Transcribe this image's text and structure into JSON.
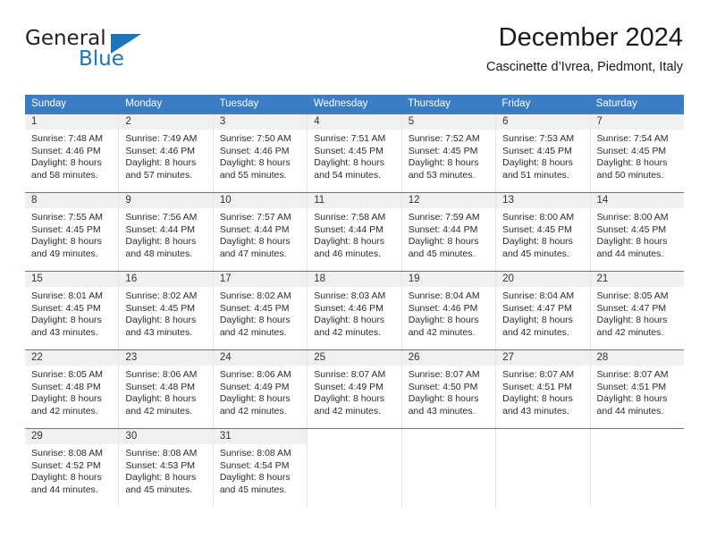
{
  "brand": {
    "name_top": "General",
    "name_bottom": "Blue",
    "color_top": "#231f20",
    "color_bottom": "#1b75bb",
    "triangle_icon": "triangle-icon"
  },
  "header": {
    "title": "December 2024",
    "subtitle": "Cascinette d’Ivrea, Piedmont, Italy"
  },
  "theme": {
    "header_blue": "#3b7dc4",
    "daynum_band": "#f0f0f0",
    "grid_line": "#e6e6e6",
    "row_top_border": "#4a7fbd"
  },
  "weekdays": [
    "Sunday",
    "Monday",
    "Tuesday",
    "Wednesday",
    "Thursday",
    "Friday",
    "Saturday"
  ],
  "weeks": [
    [
      {
        "day": "1",
        "sunrise": "Sunrise: 7:48 AM",
        "sunset": "Sunset: 4:46 PM",
        "daylight1": "Daylight: 8 hours",
        "daylight2": "and 58 minutes."
      },
      {
        "day": "2",
        "sunrise": "Sunrise: 7:49 AM",
        "sunset": "Sunset: 4:46 PM",
        "daylight1": "Daylight: 8 hours",
        "daylight2": "and 57 minutes."
      },
      {
        "day": "3",
        "sunrise": "Sunrise: 7:50 AM",
        "sunset": "Sunset: 4:46 PM",
        "daylight1": "Daylight: 8 hours",
        "daylight2": "and 55 minutes."
      },
      {
        "day": "4",
        "sunrise": "Sunrise: 7:51 AM",
        "sunset": "Sunset: 4:45 PM",
        "daylight1": "Daylight: 8 hours",
        "daylight2": "and 54 minutes."
      },
      {
        "day": "5",
        "sunrise": "Sunrise: 7:52 AM",
        "sunset": "Sunset: 4:45 PM",
        "daylight1": "Daylight: 8 hours",
        "daylight2": "and 53 minutes."
      },
      {
        "day": "6",
        "sunrise": "Sunrise: 7:53 AM",
        "sunset": "Sunset: 4:45 PM",
        "daylight1": "Daylight: 8 hours",
        "daylight2": "and 51 minutes."
      },
      {
        "day": "7",
        "sunrise": "Sunrise: 7:54 AM",
        "sunset": "Sunset: 4:45 PM",
        "daylight1": "Daylight: 8 hours",
        "daylight2": "and 50 minutes."
      }
    ],
    [
      {
        "day": "8",
        "sunrise": "Sunrise: 7:55 AM",
        "sunset": "Sunset: 4:45 PM",
        "daylight1": "Daylight: 8 hours",
        "daylight2": "and 49 minutes."
      },
      {
        "day": "9",
        "sunrise": "Sunrise: 7:56 AM",
        "sunset": "Sunset: 4:44 PM",
        "daylight1": "Daylight: 8 hours",
        "daylight2": "and 48 minutes."
      },
      {
        "day": "10",
        "sunrise": "Sunrise: 7:57 AM",
        "sunset": "Sunset: 4:44 PM",
        "daylight1": "Daylight: 8 hours",
        "daylight2": "and 47 minutes."
      },
      {
        "day": "11",
        "sunrise": "Sunrise: 7:58 AM",
        "sunset": "Sunset: 4:44 PM",
        "daylight1": "Daylight: 8 hours",
        "daylight2": "and 46 minutes."
      },
      {
        "day": "12",
        "sunrise": "Sunrise: 7:59 AM",
        "sunset": "Sunset: 4:44 PM",
        "daylight1": "Daylight: 8 hours",
        "daylight2": "and 45 minutes."
      },
      {
        "day": "13",
        "sunrise": "Sunrise: 8:00 AM",
        "sunset": "Sunset: 4:45 PM",
        "daylight1": "Daylight: 8 hours",
        "daylight2": "and 45 minutes."
      },
      {
        "day": "14",
        "sunrise": "Sunrise: 8:00 AM",
        "sunset": "Sunset: 4:45 PM",
        "daylight1": "Daylight: 8 hours",
        "daylight2": "and 44 minutes."
      }
    ],
    [
      {
        "day": "15",
        "sunrise": "Sunrise: 8:01 AM",
        "sunset": "Sunset: 4:45 PM",
        "daylight1": "Daylight: 8 hours",
        "daylight2": "and 43 minutes."
      },
      {
        "day": "16",
        "sunrise": "Sunrise: 8:02 AM",
        "sunset": "Sunset: 4:45 PM",
        "daylight1": "Daylight: 8 hours",
        "daylight2": "and 43 minutes."
      },
      {
        "day": "17",
        "sunrise": "Sunrise: 8:02 AM",
        "sunset": "Sunset: 4:45 PM",
        "daylight1": "Daylight: 8 hours",
        "daylight2": "and 42 minutes."
      },
      {
        "day": "18",
        "sunrise": "Sunrise: 8:03 AM",
        "sunset": "Sunset: 4:46 PM",
        "daylight1": "Daylight: 8 hours",
        "daylight2": "and 42 minutes."
      },
      {
        "day": "19",
        "sunrise": "Sunrise: 8:04 AM",
        "sunset": "Sunset: 4:46 PM",
        "daylight1": "Daylight: 8 hours",
        "daylight2": "and 42 minutes."
      },
      {
        "day": "20",
        "sunrise": "Sunrise: 8:04 AM",
        "sunset": "Sunset: 4:47 PM",
        "daylight1": "Daylight: 8 hours",
        "daylight2": "and 42 minutes."
      },
      {
        "day": "21",
        "sunrise": "Sunrise: 8:05 AM",
        "sunset": "Sunset: 4:47 PM",
        "daylight1": "Daylight: 8 hours",
        "daylight2": "and 42 minutes."
      }
    ],
    [
      {
        "day": "22",
        "sunrise": "Sunrise: 8:05 AM",
        "sunset": "Sunset: 4:48 PM",
        "daylight1": "Daylight: 8 hours",
        "daylight2": "and 42 minutes."
      },
      {
        "day": "23",
        "sunrise": "Sunrise: 8:06 AM",
        "sunset": "Sunset: 4:48 PM",
        "daylight1": "Daylight: 8 hours",
        "daylight2": "and 42 minutes."
      },
      {
        "day": "24",
        "sunrise": "Sunrise: 8:06 AM",
        "sunset": "Sunset: 4:49 PM",
        "daylight1": "Daylight: 8 hours",
        "daylight2": "and 42 minutes."
      },
      {
        "day": "25",
        "sunrise": "Sunrise: 8:07 AM",
        "sunset": "Sunset: 4:49 PM",
        "daylight1": "Daylight: 8 hours",
        "daylight2": "and 42 minutes."
      },
      {
        "day": "26",
        "sunrise": "Sunrise: 8:07 AM",
        "sunset": "Sunset: 4:50 PM",
        "daylight1": "Daylight: 8 hours",
        "daylight2": "and 43 minutes."
      },
      {
        "day": "27",
        "sunrise": "Sunrise: 8:07 AM",
        "sunset": "Sunset: 4:51 PM",
        "daylight1": "Daylight: 8 hours",
        "daylight2": "and 43 minutes."
      },
      {
        "day": "28",
        "sunrise": "Sunrise: 8:07 AM",
        "sunset": "Sunset: 4:51 PM",
        "daylight1": "Daylight: 8 hours",
        "daylight2": "and 44 minutes."
      }
    ],
    [
      {
        "day": "29",
        "sunrise": "Sunrise: 8:08 AM",
        "sunset": "Sunset: 4:52 PM",
        "daylight1": "Daylight: 8 hours",
        "daylight2": "and 44 minutes."
      },
      {
        "day": "30",
        "sunrise": "Sunrise: 8:08 AM",
        "sunset": "Sunset: 4:53 PM",
        "daylight1": "Daylight: 8 hours",
        "daylight2": "and 45 minutes."
      },
      {
        "day": "31",
        "sunrise": "Sunrise: 8:08 AM",
        "sunset": "Sunset: 4:54 PM",
        "daylight1": "Daylight: 8 hours",
        "daylight2": "and 45 minutes."
      },
      {
        "day": "",
        "sunrise": "",
        "sunset": "",
        "daylight1": "",
        "daylight2": ""
      },
      {
        "day": "",
        "sunrise": "",
        "sunset": "",
        "daylight1": "",
        "daylight2": ""
      },
      {
        "day": "",
        "sunrise": "",
        "sunset": "",
        "daylight1": "",
        "daylight2": ""
      },
      {
        "day": "",
        "sunrise": "",
        "sunset": "",
        "daylight1": "",
        "daylight2": ""
      }
    ]
  ]
}
